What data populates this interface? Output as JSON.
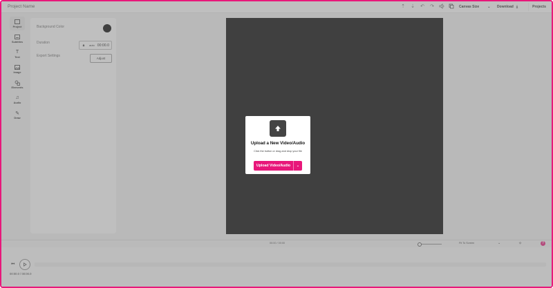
{
  "header": {
    "project_name": "Project Name",
    "canvas_size_label": "Canvas Size",
    "download_label": "Download",
    "projects_label": "Projects"
  },
  "rail": {
    "items": [
      {
        "label": "Project",
        "icon": "project-icon"
      },
      {
        "label": "Subtitles",
        "icon": "subtitles-icon"
      },
      {
        "label": "Text",
        "icon": "text-icon"
      },
      {
        "label": "Image",
        "icon": "image-icon"
      },
      {
        "label": "Elements",
        "icon": "elements-icon"
      },
      {
        "label": "Audio",
        "icon": "audio-icon"
      },
      {
        "label": "Draw",
        "icon": "draw-icon"
      }
    ]
  },
  "panel": {
    "background_color_label": "Background Color",
    "background_color_value": "#000000",
    "duration_label": "Duration",
    "duration_mode": "auto",
    "duration_value": "00:00.0",
    "export_settings_label": "Export Settings",
    "adjust_label": "Adjust"
  },
  "timeline": {
    "time_readout": "00:00 / 00:00",
    "fit_label": "Fit To Screen",
    "playback_time": "00:00.0 / 00:00.0"
  },
  "modal": {
    "title": "Upload a New Video/Audio",
    "subtitle": "Click the button or drag and drop your file",
    "button_label": "Upload Video/Audio"
  },
  "colors": {
    "accent": "#e8177a",
    "canvas": "#000000"
  }
}
